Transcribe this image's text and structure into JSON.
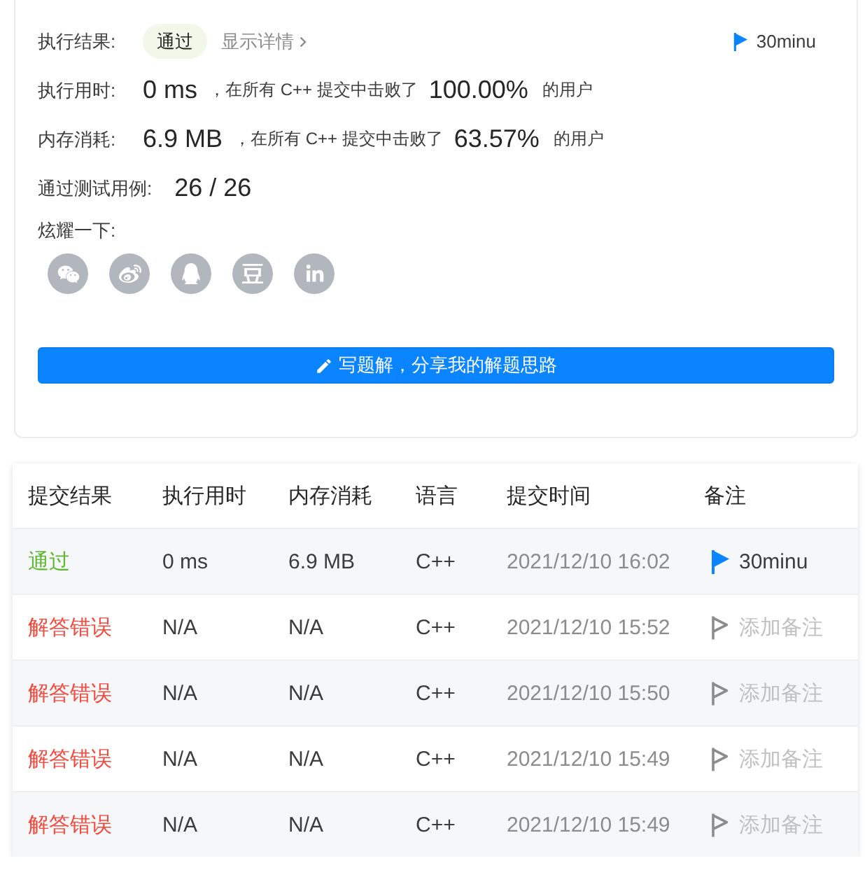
{
  "result": {
    "label": "执行结果:",
    "status": {
      "text": "通过",
      "kind": "accepted"
    },
    "details_link": "显示详情",
    "note": {
      "flagged": true,
      "text": "30minu"
    }
  },
  "stats": [
    {
      "label": "执行用时:",
      "value": "0 ms",
      "comparison": "，在所有 C++ 提交中击败了",
      "percent": "100.00%",
      "suffix": "的用户"
    },
    {
      "label": "内存消耗:",
      "value": "6.9 MB",
      "comparison": "，在所有 C++ 提交中击败了",
      "percent": "63.57%",
      "suffix": "的用户"
    }
  ],
  "test_cases": {
    "label": "通过测试用例:",
    "value": "26 / 26"
  },
  "share": {
    "label": "炫耀一下:"
  },
  "solution_button": {
    "label": "写题解，分享我的解题思路"
  },
  "table": {
    "columns": [
      "提交结果",
      "执行用时",
      "内存消耗",
      "语言",
      "提交时间",
      "备注"
    ],
    "rows": [
      {
        "result": {
          "text": "通过",
          "kind": "accepted"
        },
        "runtime": "0 ms",
        "memory": "6.9 MB",
        "language": "C++",
        "submitted_at": "2021/12/10 16:02",
        "note": {
          "flagged": true,
          "text": "30minu"
        }
      },
      {
        "result": {
          "text": "解答错误",
          "kind": "wrong_answer"
        },
        "runtime": "N/A",
        "memory": "N/A",
        "language": "C++",
        "submitted_at": "2021/12/10 15:52",
        "note": {
          "flagged": false,
          "text": "添加备注"
        }
      },
      {
        "result": {
          "text": "解答错误",
          "kind": "wrong_answer"
        },
        "runtime": "N/A",
        "memory": "N/A",
        "language": "C++",
        "submitted_at": "2021/12/10 15:50",
        "note": {
          "flagged": false,
          "text": "添加备注"
        }
      },
      {
        "result": {
          "text": "解答错误",
          "kind": "wrong_answer"
        },
        "runtime": "N/A",
        "memory": "N/A",
        "language": "C++",
        "submitted_at": "2021/12/10 15:49",
        "note": {
          "flagged": false,
          "text": "添加备注"
        }
      },
      {
        "result": {
          "text": "解答错误",
          "kind": "wrong_answer"
        },
        "runtime": "N/A",
        "memory": "N/A",
        "language": "C++",
        "submitted_at": "2021/12/10 15:49",
        "note": {
          "flagged": false,
          "text": "添加备注"
        }
      }
    ]
  }
}
